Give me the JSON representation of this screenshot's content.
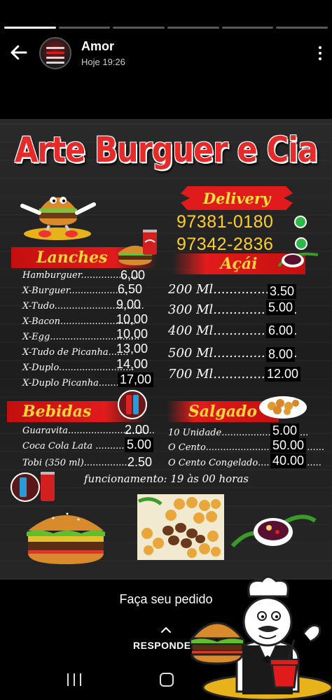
{
  "story": {
    "segments_total": 6,
    "segments_done": 1,
    "user_name": "Amor",
    "time": "Hoje 19:26"
  },
  "flyer": {
    "title": "Arte Burguer e Cia",
    "delivery": "Delivery",
    "phones": [
      "97381-0180",
      "97342-2836"
    ],
    "lanches": {
      "heading": "Lanches",
      "items": [
        {
          "name": "Hamburguer....................",
          "price": "6,00"
        },
        {
          "name": "X-Burguer....................",
          "price": "6,50"
        },
        {
          "name": "X-Tudo...............................",
          "price": "9,00"
        },
        {
          "name": "X-Bacon..........................",
          "price": "10,00"
        },
        {
          "name": "X-Egg...............................",
          "price": "10,00"
        },
        {
          "name": "X-Tudo de Picanha.......",
          "price": "13,00"
        },
        {
          "name": "X-Duplo..........................",
          "price": "14,00"
        },
        {
          "name": "X-Duplo Picanha...........",
          "price": "17,00"
        }
      ]
    },
    "acai": {
      "heading": "Açái",
      "items": [
        {
          "size": "200 Ml.....................",
          "price": "3.50"
        },
        {
          "size": "300 Ml.....................",
          "price": "5.00"
        },
        {
          "size": "400 Ml.....................",
          "price": "6.00"
        },
        {
          "size": "500 Ml.....................",
          "price": "8.00"
        },
        {
          "size": "700 Ml.....................",
          "price": "12.00"
        }
      ]
    },
    "bebidas": {
      "heading": "Bebidas",
      "items": [
        {
          "name": "Guaravita..............................",
          "price": "2.00"
        },
        {
          "name": "Coca Cola Lata ..............",
          "price": "5.00"
        },
        {
          "name": "Tobi (350 ml)................",
          "price": "2.50"
        }
      ]
    },
    "salgado": {
      "heading": "Salgado",
      "items": [
        {
          "name": "10 Unidade..............................",
          "price": "5.00"
        },
        {
          "name": "O Cento.........................................",
          "price": "50.00"
        },
        {
          "name": "O Cento Congelado......................",
          "price": "40.00"
        }
      ]
    },
    "hours": "funcionamento: 19 às 00 horas"
  },
  "footer": {
    "cta": "Faça seu pedido",
    "reply": "RESPONDE"
  },
  "colors": {
    "brand_red": "#e11b1b",
    "accent_yellow": "#ffd33a",
    "whatsapp_green": "#2fb84a"
  },
  "icons": {
    "back": "arrow-left-icon",
    "more": "more-vertical-icon",
    "whatsapp": "whatsapp-icon",
    "reply": "chevron-up-icon",
    "recent": "recent-apps-icon",
    "home": "home-icon"
  }
}
